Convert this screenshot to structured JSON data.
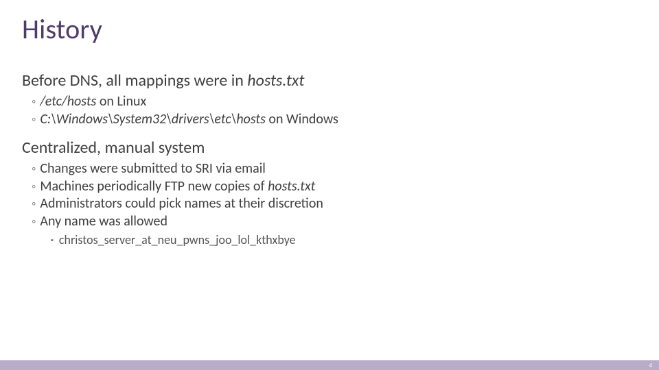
{
  "title": "History",
  "section1": {
    "heading_pre": "Before DNS, all mappings were in ",
    "heading_em": "hosts.txt",
    "items": [
      {
        "em": "/etc/hosts",
        "post": " on Linux"
      },
      {
        "em": "C:\\Windows\\System32\\drivers\\etc\\hosts",
        "post": " on Windows"
      }
    ]
  },
  "section2": {
    "heading": "Centralized, manual system",
    "items": [
      {
        "pre": "Changes were submitted to SRI via email"
      },
      {
        "pre": "Machines periodically FTP new copies of ",
        "em": "hosts.txt"
      },
      {
        "pre": "Administrators could pick names at their discretion"
      },
      {
        "pre": "Any name was allowed"
      }
    ],
    "subsub": [
      "christos_server_at_neu_pwns_joo_lol_kthxbye"
    ]
  },
  "page_number": "4",
  "bullet_glyph": "◦",
  "square_glyph": "▪"
}
